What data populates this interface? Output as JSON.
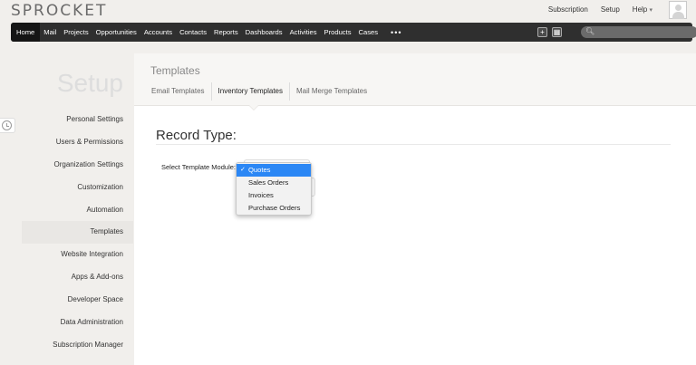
{
  "app": {
    "logo": "SPROCKET"
  },
  "toplinks": {
    "subscription": "Subscription",
    "setup": "Setup",
    "help": "Help",
    "help_caret": "▾"
  },
  "nav": {
    "items": [
      "Home",
      "Mail",
      "Projects",
      "Opportunities",
      "Accounts",
      "Contacts",
      "Reports",
      "Dashboards",
      "Activities",
      "Products",
      "Cases"
    ],
    "more": "•••",
    "add_icon": "+",
    "calendar_icon": "▦",
    "search_icon": "🔍︎"
  },
  "sidebar": {
    "title": "Setup",
    "items": [
      "Personal Settings",
      "Users & Permissions",
      "Organization Settings",
      "Customization",
      "Automation",
      "Templates",
      "Website Integration",
      "Apps & Add-ons",
      "Developer Space",
      "Data Administration",
      "Subscription Manager"
    ],
    "active": "Templates"
  },
  "main": {
    "title": "Templates",
    "tabs": [
      "Email Templates",
      "Inventory Templates",
      "Mail Merge Templates"
    ],
    "active_tab": "Inventory Templates",
    "record_type_heading": "Record Type:",
    "select_label": "Select Template Module:",
    "dropdown": {
      "check": "✓",
      "options": [
        "Quotes",
        "Sales Orders",
        "Invoices",
        "Purchase Orders"
      ],
      "selected": "Quotes"
    }
  },
  "colors": {
    "nav_bg": "#2f2f2f",
    "accent": "#2b87f5",
    "page_bg": "#f1efec"
  }
}
